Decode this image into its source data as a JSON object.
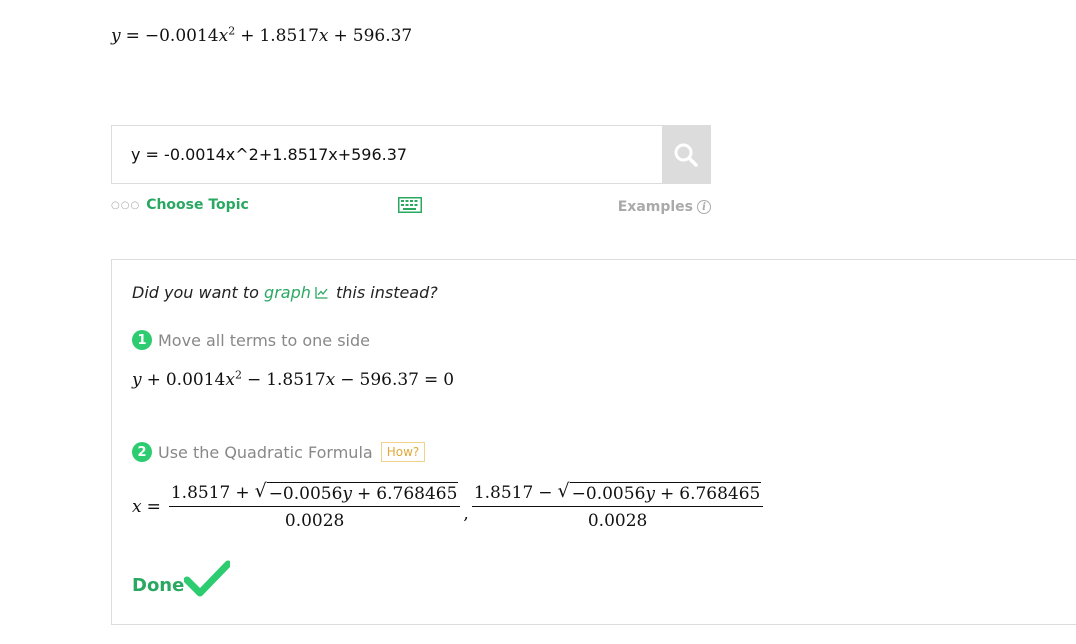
{
  "header_equation": {
    "y": "y",
    "equals": "=",
    "term1": "−0.0014",
    "x1": "x",
    "exp1": "2",
    "plus1": "+",
    "term2": "1.8517",
    "x2": "x",
    "plus2": "+",
    "term3": "596.37"
  },
  "search": {
    "value": "y = -0.0014x^2+1.8517x+596.37",
    "button_icon": "search-icon"
  },
  "below_search": {
    "dots": "○○○",
    "choose_topic": "Choose Topic",
    "keyboard_icon": "keyboard-icon",
    "examples": "Examples",
    "info_symbol": "i"
  },
  "solution": {
    "prompt_before": "Did you want to",
    "graph_link": "graph",
    "prompt_after": "this instead?",
    "steps": [
      {
        "number": "1",
        "title": "Move all terms to one side",
        "equation": {
          "y": "y",
          "plus": "+",
          "coef": "0.0014",
          "x": "x",
          "exp": "2",
          "minus1": "−",
          "term2": "1.8517",
          "x2": "x",
          "minus2": "−",
          "term3": "596.37",
          "equals": "=",
          "rhs": "0"
        }
      },
      {
        "number": "2",
        "title": "Use the Quadratic Formula",
        "how": "How?",
        "formula": {
          "lhs": "x",
          "equals": "=",
          "numerator_prefix1": "1.8517",
          "op1": "+",
          "numerator_prefix2": "1.8517",
          "op2": "−",
          "radicand_coef": "−0.0056",
          "radicand_var": "y",
          "radicand_plus": "+",
          "radicand_const": "6.768465",
          "denominator": "0.0028",
          "separator": ","
        }
      }
    ],
    "done_label": "Done"
  },
  "colors": {
    "accent_green": "#2aa862",
    "step_green": "#2ecc71",
    "how_orange": "#e0a93a",
    "search_button_bg": "#dcdcdc"
  }
}
